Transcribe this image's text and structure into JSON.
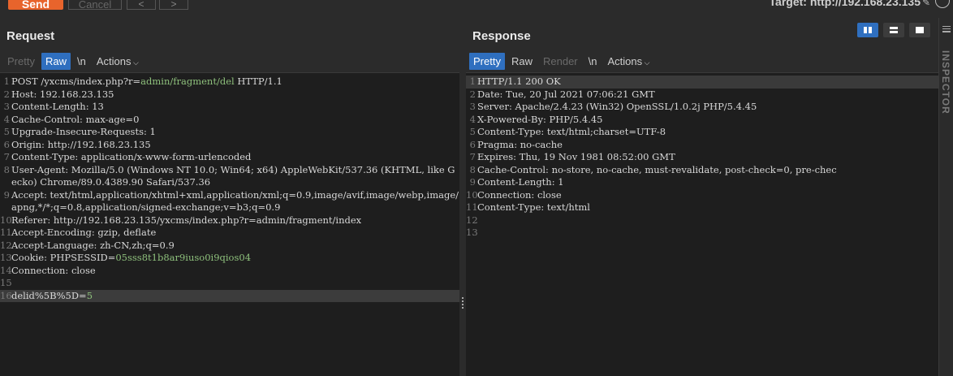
{
  "toolbar": {
    "send_label": "Send",
    "cancel_label": "Cancel",
    "back_label": "<",
    "forward_label": ">",
    "target_text": "Target: http://192.168.23.135"
  },
  "request": {
    "title": "Request",
    "tabs": [
      "Pretty",
      "Raw",
      "\\n",
      "Actions"
    ],
    "lines": [
      {
        "n": "1",
        "parts": [
          {
            "t": "POST /yxcms/index.php?r=",
            "c": "k"
          },
          {
            "t": "admin/fragment/del",
            "c": "g"
          },
          {
            "t": " HTTP/1.1",
            "c": "k"
          }
        ]
      },
      {
        "n": "2",
        "parts": [
          {
            "t": "Host: 192.168.23.135",
            "c": "k"
          }
        ]
      },
      {
        "n": "3",
        "parts": [
          {
            "t": "Content-Length: 13",
            "c": "k"
          }
        ]
      },
      {
        "n": "4",
        "parts": [
          {
            "t": "Cache-Control: max-age=0",
            "c": "k"
          }
        ]
      },
      {
        "n": "5",
        "parts": [
          {
            "t": "Upgrade-Insecure-Requests: 1",
            "c": "k"
          }
        ]
      },
      {
        "n": "6",
        "parts": [
          {
            "t": "Origin: http://192.168.23.135",
            "c": "k"
          }
        ]
      },
      {
        "n": "7",
        "parts": [
          {
            "t": "Content-Type: application/x-www-form-urlencoded",
            "c": "k"
          }
        ]
      },
      {
        "n": "8",
        "parts": [
          {
            "t": "User-Agent: Mozilla/5.0 (Windows NT 10.0; Win64; x64) AppleWebKit/537.36 (KHTML, like Gecko) Chrome/89.0.4389.90 Safari/537.36",
            "c": "k"
          }
        ]
      },
      {
        "n": "9",
        "parts": [
          {
            "t": "Accept: text/html,application/xhtml+xml,application/xml;q=0.9,image/avif,image/webp,image/apng,*/*;q=0.8,application/signed-exchange;v=b3;q=0.9",
            "c": "k"
          }
        ]
      },
      {
        "n": "10",
        "parts": [
          {
            "t": "Referer: http://192.168.23.135/yxcms/index.php?r=admin/fragment/index",
            "c": "k"
          }
        ]
      },
      {
        "n": "11",
        "parts": [
          {
            "t": "Accept-Encoding: gzip, deflate",
            "c": "k"
          }
        ]
      },
      {
        "n": "12",
        "parts": [
          {
            "t": "Accept-Language: zh-CN,zh;q=0.9",
            "c": "k"
          }
        ]
      },
      {
        "n": "13",
        "parts": [
          {
            "t": "Cookie: PHPSESSID=",
            "c": "k"
          },
          {
            "t": "05sss8t1b8ar9iuso0i9qios04",
            "c": "g"
          }
        ]
      },
      {
        "n": "14",
        "parts": [
          {
            "t": "Connection: close",
            "c": "k"
          }
        ]
      },
      {
        "n": "15",
        "parts": [
          {
            "t": "",
            "c": "k"
          }
        ]
      },
      {
        "n": "16",
        "parts": [
          {
            "t": "delid%5B%5D=",
            "c": "k"
          },
          {
            "t": "5",
            "c": "g"
          }
        ]
      }
    ]
  },
  "response": {
    "title": "Response",
    "tabs": [
      "Pretty",
      "Raw",
      "Render",
      "\\n",
      "Actions"
    ],
    "lines": [
      {
        "n": "1",
        "parts": [
          {
            "t": "HTTP/1.1 200 OK",
            "c": "k"
          }
        ]
      },
      {
        "n": "2",
        "parts": [
          {
            "t": "Date: Tue, 20 Jul 2021 07:06:21 GMT",
            "c": "k"
          }
        ]
      },
      {
        "n": "3",
        "parts": [
          {
            "t": "Server: Apache/2.4.23 (Win32) OpenSSL/1.0.2j PHP/5.4.45",
            "c": "k"
          }
        ]
      },
      {
        "n": "4",
        "parts": [
          {
            "t": "X-Powered-By: PHP/5.4.45",
            "c": "k"
          }
        ]
      },
      {
        "n": "5",
        "parts": [
          {
            "t": "Content-Type: text/html;charset=UTF-8",
            "c": "k"
          }
        ]
      },
      {
        "n": "6",
        "parts": [
          {
            "t": "Pragma: no-cache",
            "c": "k"
          }
        ]
      },
      {
        "n": "7",
        "parts": [
          {
            "t": "Expires: Thu, 19 Nov 1981 08:52:00 GMT",
            "c": "k"
          }
        ]
      },
      {
        "n": "8",
        "parts": [
          {
            "t": "Cache-Control: no-store, no-cache, must-revalidate, post-check=0, pre-chec",
            "c": "k"
          }
        ]
      },
      {
        "n": "9",
        "parts": [
          {
            "t": "Content-Length: 1",
            "c": "k"
          }
        ]
      },
      {
        "n": "10",
        "parts": [
          {
            "t": "Connection: close",
            "c": "k"
          }
        ]
      },
      {
        "n": "11",
        "parts": [
          {
            "t": "Content-Type: text/html",
            "c": "k"
          }
        ]
      },
      {
        "n": "12",
        "parts": [
          {
            "t": "",
            "c": "k"
          }
        ]
      },
      {
        "n": "13",
        "parts": [
          {
            "t": "",
            "c": "k"
          }
        ]
      }
    ]
  },
  "inspector": {
    "label": "INSPECTOR"
  },
  "colors": {
    "send": "#e8642c",
    "active_tab": "#2f6fbf",
    "value_green": "#8ec07c"
  }
}
